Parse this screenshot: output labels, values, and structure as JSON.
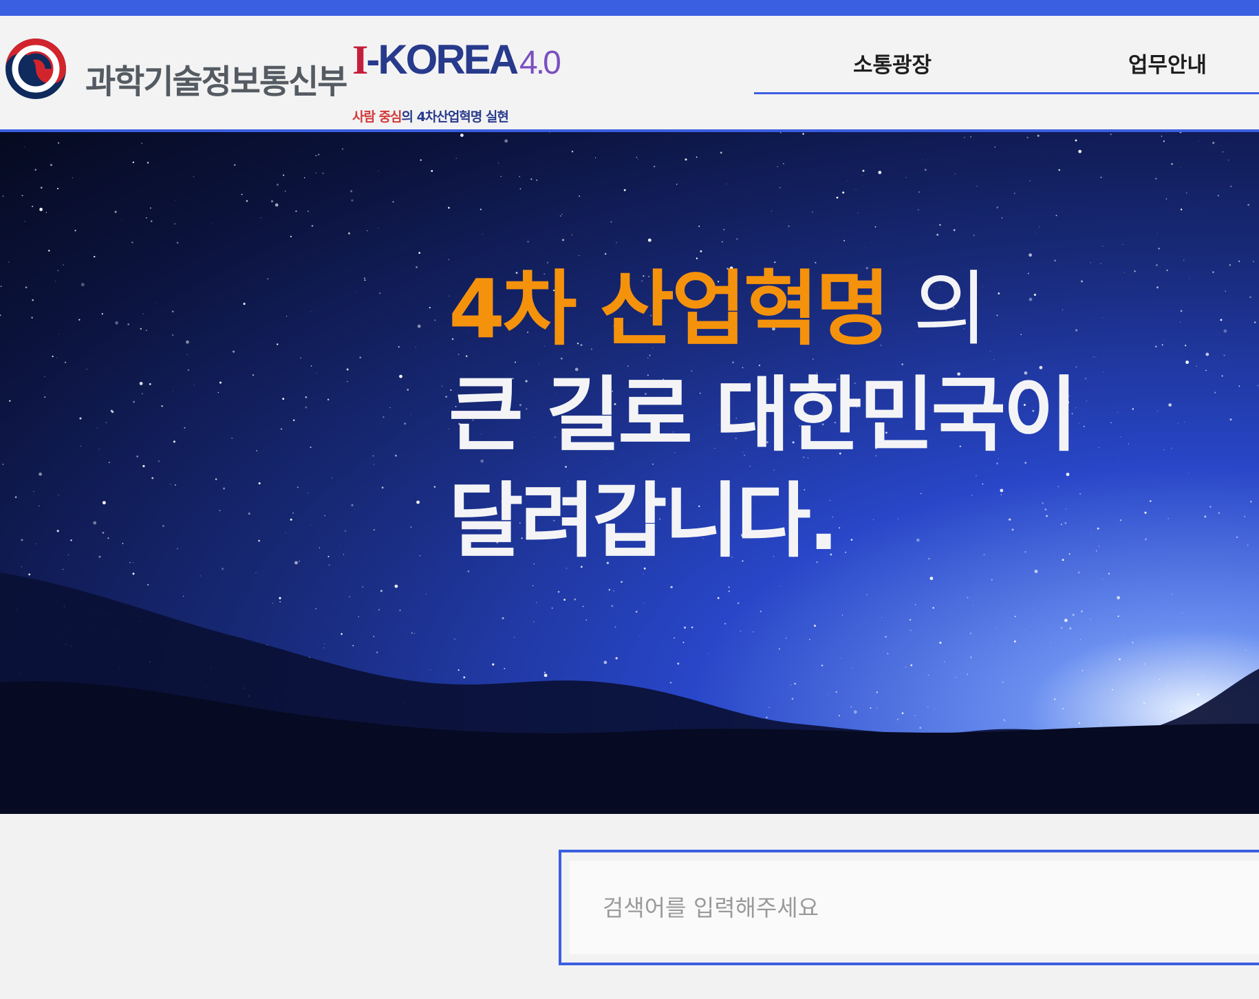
{
  "header": {
    "ministry_name": "과학기술정보통신부",
    "logo": {
      "i": "I",
      "korea": "-KOREA",
      "version": "4.0",
      "tagline_red": "사람 중심",
      "tagline_blue": "의 4차산업혁명 실현"
    }
  },
  "nav": {
    "items": [
      {
        "label": "소통광장"
      },
      {
        "label": "업무안내"
      }
    ]
  },
  "hero": {
    "line1_highlight": "4차 산업혁명",
    "line1_rest": "의",
    "line2": "큰 길로 대한민국이",
    "line3": "달려갑니다."
  },
  "search": {
    "placeholder": "검색어를 입력해주세요"
  },
  "colors": {
    "accent": "#3a5fe0",
    "highlight": "#f5920c",
    "ministry_text": "#555b62"
  }
}
